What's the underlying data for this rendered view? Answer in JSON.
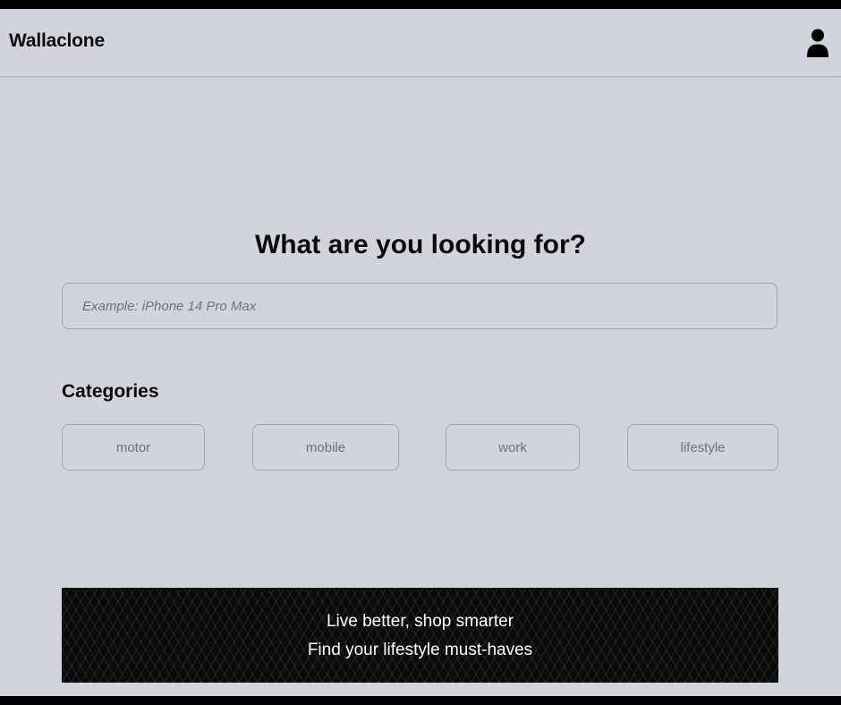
{
  "header": {
    "brand": "Wallaclone",
    "user_icon": "user-icon"
  },
  "hero": {
    "title": "What are you looking for?"
  },
  "search": {
    "placeholder": "Example: iPhone 14 Pro Max",
    "value": ""
  },
  "categories": {
    "title": "Categories",
    "items": [
      {
        "label": "motor"
      },
      {
        "label": "mobile"
      },
      {
        "label": "work"
      },
      {
        "label": "lifestyle"
      }
    ]
  },
  "banner": {
    "line1": "Live better, shop smarter",
    "line2": "Find your lifestyle must-haves"
  },
  "colors": {
    "background": "#d1d5db",
    "text": "#0b0b0b",
    "muted": "#6b7280",
    "border": "#9ca3af",
    "banner_bg": "#0a0a0a",
    "banner_text": "#ffffff"
  }
}
